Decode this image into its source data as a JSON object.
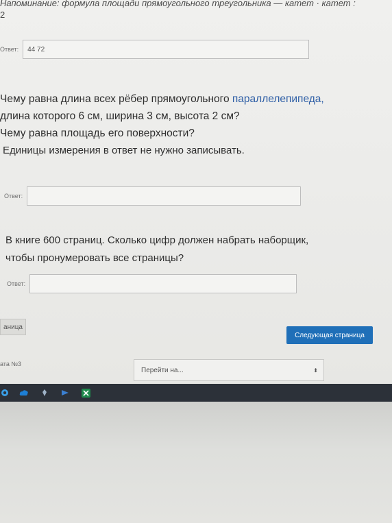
{
  "reminder": {
    "line1": "Напоминание: формула площади прямоугольного треугольника — катет · катет :",
    "line2": "2"
  },
  "answer1": {
    "label": "Ответ:",
    "value": "44 72"
  },
  "question1": {
    "line1_prefix": "Чему равна длина всех рёбер прямоугольного ",
    "line1_link": "параллелепипеда,",
    "line2": "длина которого 6 см, ширина 3 см, высота 2 см?",
    "line3": "Чему равна площадь его поверхности?",
    "line4": "Единицы измерения в ответ не нужно записывать."
  },
  "answer2": {
    "label": "Ответ:",
    "value": ""
  },
  "question2": {
    "line1": "В книге 600 страниц. Сколько цифр должен набрать наборщик,",
    "line2": "чтобы пронумеровать все страницы?"
  },
  "answer3": {
    "label": "Ответ:",
    "value": ""
  },
  "navigation": {
    "prev_label": "аница",
    "next_label": "Следующая страница",
    "quiz_label": "ата №3",
    "jump_placeholder": "Перейти на...",
    "jump_arrow": "⬍"
  },
  "taskbar": {
    "icons": [
      "edge-icon",
      "cloud-icon",
      "pin-icon",
      "arrow-icon",
      "excel-icon"
    ],
    "colors": {
      "accent": "#1f6fb8",
      "link": "#2f5fa6",
      "taskbar": "#2c3139"
    }
  }
}
